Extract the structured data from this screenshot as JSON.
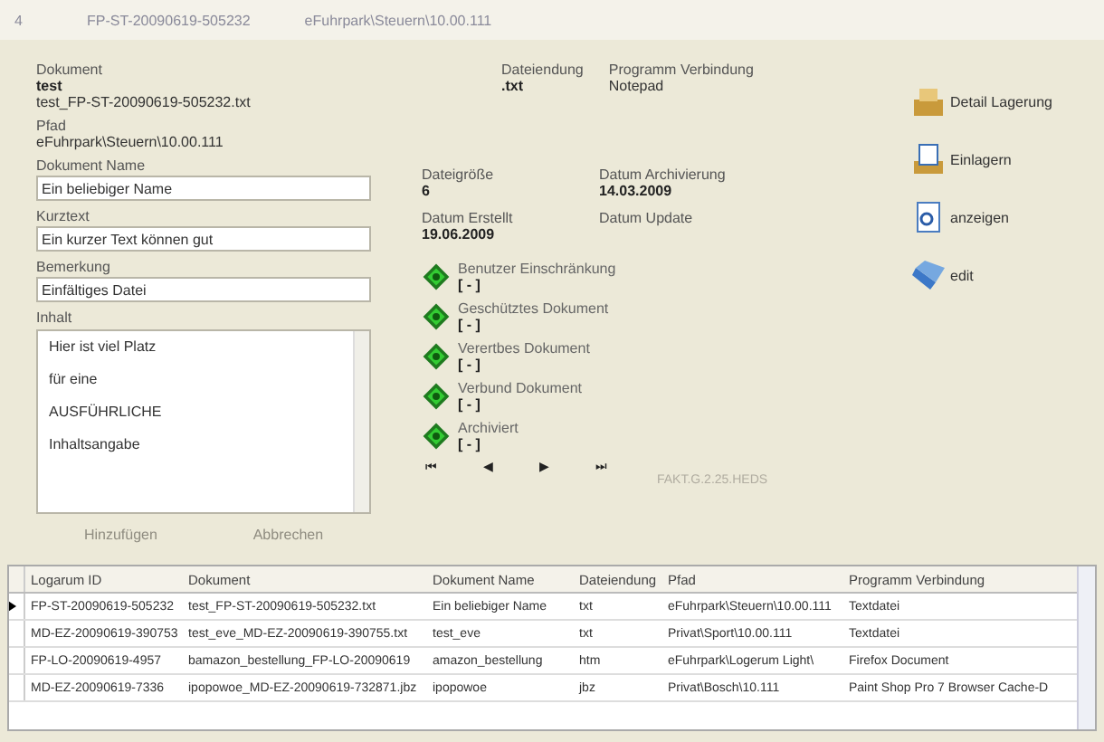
{
  "header": {
    "record_no": "4",
    "document_id": "FP-ST-20090619-505232",
    "path": "eFuhrpark\\Steuern\\10.00.111"
  },
  "document": {
    "label": "Dokument",
    "name": "test",
    "file": "test_FP-ST-20090619-505232.txt"
  },
  "path": {
    "label": "Pfad",
    "value": "eFuhrpark\\Steuern\\10.00.111"
  },
  "extension": {
    "label": "Dateiendung",
    "value": ".txt"
  },
  "program": {
    "label": "Programm Verbindung",
    "value": "Notepad"
  },
  "fields": [
    {
      "label": "Dokument Name",
      "value": "Ein beliebiger Name"
    },
    {
      "label": "Kurztext",
      "value": "Ein kurzer Text können gut"
    },
    {
      "label": "Bemerkung",
      "value": "Einfältiges Datei"
    }
  ],
  "content": {
    "label": "Inhalt",
    "lines": [
      "Hier ist viel Platz",
      "für eine",
      "AUSFÜHRLICHE",
      "Inhaltsangabe"
    ]
  },
  "form_buttons": [
    {
      "label": "Hinzufügen",
      "disabled": true
    },
    {
      "label": "Abbrechen",
      "disabled": true
    }
  ],
  "size": {
    "label": "Dateigröße",
    "value": "6"
  },
  "created": {
    "label": "Datum Erstellt",
    "value": "19.06.2009"
  },
  "archived": {
    "label": "Datum Archivierung",
    "value": "14.03.2009"
  },
  "updated": {
    "label": "Datum Update"
  },
  "flags": [
    {
      "label": "Benutzer Einschränkung",
      "value": "[ - ]"
    },
    {
      "label": "Geschütztes Dokument",
      "value": "[ - ]"
    },
    {
      "label": "Verertbes Dokument",
      "value": "[ - ]"
    },
    {
      "label": "Verbund Dokument",
      "value": "[ - ]"
    },
    {
      "label": "Archiviert",
      "value": "[ - ]"
    }
  ],
  "nav": [
    "⏮",
    "◀",
    "▶",
    "⏭"
  ],
  "record_info": "FAKT.G.2.25.HEDS",
  "actions": [
    {
      "label": "Detail Lagerung",
      "kind": "detail"
    },
    {
      "label": "Einlagern",
      "kind": "store"
    },
    {
      "label": "anzeigen",
      "kind": "view"
    },
    {
      "label": "edit",
      "kind": "edit"
    }
  ],
  "table": {
    "columns": [
      "Logarum ID",
      "Dokument",
      "Dokument Name",
      "Dateiendung",
      "Pfad",
      "Programm Verbindung"
    ],
    "rows": [
      {
        "selected": true,
        "cells": [
          "FP-ST-20090619-505232",
          "test_FP-ST-20090619-505232.txt",
          "Ein beliebiger Name",
          "txt",
          "eFuhrpark\\Steuern\\10.00.111",
          "Textdatei"
        ]
      },
      {
        "selected": false,
        "cells": [
          "MD-EZ-20090619-390753",
          "test_eve_MD-EZ-20090619-390755.txt",
          "test_eve",
          "txt",
          "Privat\\Sport\\10.00.111",
          "Textdatei"
        ]
      },
      {
        "selected": false,
        "cells": [
          "FP-LO-20090619-4957",
          "bamazon_bestellung_FP-LO-20090619",
          "amazon_bestellung",
          "htm",
          "eFuhrpark\\Logerum Light\\",
          "Firefox Document"
        ]
      },
      {
        "selected": false,
        "cells": [
          "MD-EZ-20090619-7336",
          "ipopowoe_MD-EZ-20090619-732871.jbz",
          "ipopowoe",
          "jbz",
          "Privat\\Bosch\\10.111",
          "Paint Shop Pro 7 Browser Cache-D"
        ]
      }
    ]
  }
}
